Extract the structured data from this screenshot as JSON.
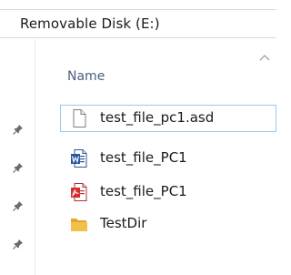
{
  "address_bar": {
    "path": "Removable Disk (E:)"
  },
  "file_list": {
    "column_header": "Name",
    "items": [
      {
        "name": "test_file_pc1.asd",
        "icon": "blank-document-icon",
        "selected": true
      },
      {
        "name": "test_file_PC1",
        "icon": "word-document-icon",
        "selected": false
      },
      {
        "name": "test_file_PC1",
        "icon": "pdf-document-icon",
        "selected": false
      },
      {
        "name": "TestDir",
        "icon": "folder-icon",
        "selected": false
      }
    ]
  },
  "colors": {
    "selection_border": "#99c9ef",
    "header_text": "#4c607a",
    "word_blue": "#2b579a",
    "pdf_red": "#d2302f",
    "folder_yellow": "#f3c04a"
  }
}
